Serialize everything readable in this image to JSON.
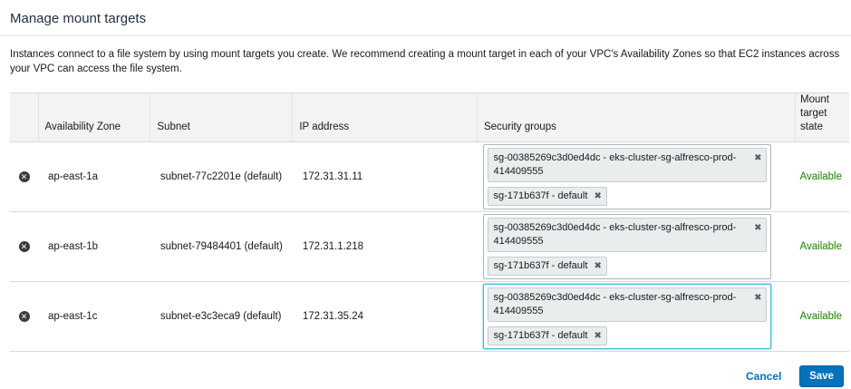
{
  "header": {
    "title": "Manage mount targets",
    "description": "Instances connect to a file system by using mount targets you create. We recommend creating a mount target in each of your VPC's Availability Zones so that EC2 instances across your VPC can access the file system."
  },
  "table": {
    "columns": {
      "availability_zone": "Availability Zone",
      "subnet": "Subnet",
      "ip_address": "IP address",
      "security_groups": "Security groups",
      "state": "Mount target state"
    },
    "rows": [
      {
        "availability_zone": "ap-east-1a",
        "subnet": "subnet-77c2201e (default)",
        "ip_address": "172.31.31.11",
        "security_groups": [
          "sg-00385269c3d0ed4dc - eks-cluster-sg-alfresco-prod-414409555",
          "sg-171b637f - default"
        ],
        "state": "Available"
      },
      {
        "availability_zone": "ap-east-1b",
        "subnet": "subnet-79484401 (default)",
        "ip_address": "172.31.1.218",
        "security_groups": [
          "sg-00385269c3d0ed4dc - eks-cluster-sg-alfresco-prod-414409555",
          "sg-171b637f - default"
        ],
        "state": "Available"
      },
      {
        "availability_zone": "ap-east-1c",
        "subnet": "subnet-e3c3eca9 (default)",
        "ip_address": "172.31.35.24",
        "security_groups": [
          "sg-00385269c3d0ed4dc - eks-cluster-sg-alfresco-prod-414409555",
          "sg-171b637f - default"
        ],
        "state": "Available"
      }
    ]
  },
  "icons": {
    "remove": "remove-circle-icon",
    "chip_remove": "close-icon"
  },
  "glyphs": {
    "remove": "✕",
    "chip_remove": "✖"
  },
  "colors": {
    "primary": "#0073bb",
    "status_available": "#1d8102",
    "focus": "#44b9d6"
  },
  "footer": {
    "cancel_label": "Cancel",
    "save_label": "Save"
  }
}
